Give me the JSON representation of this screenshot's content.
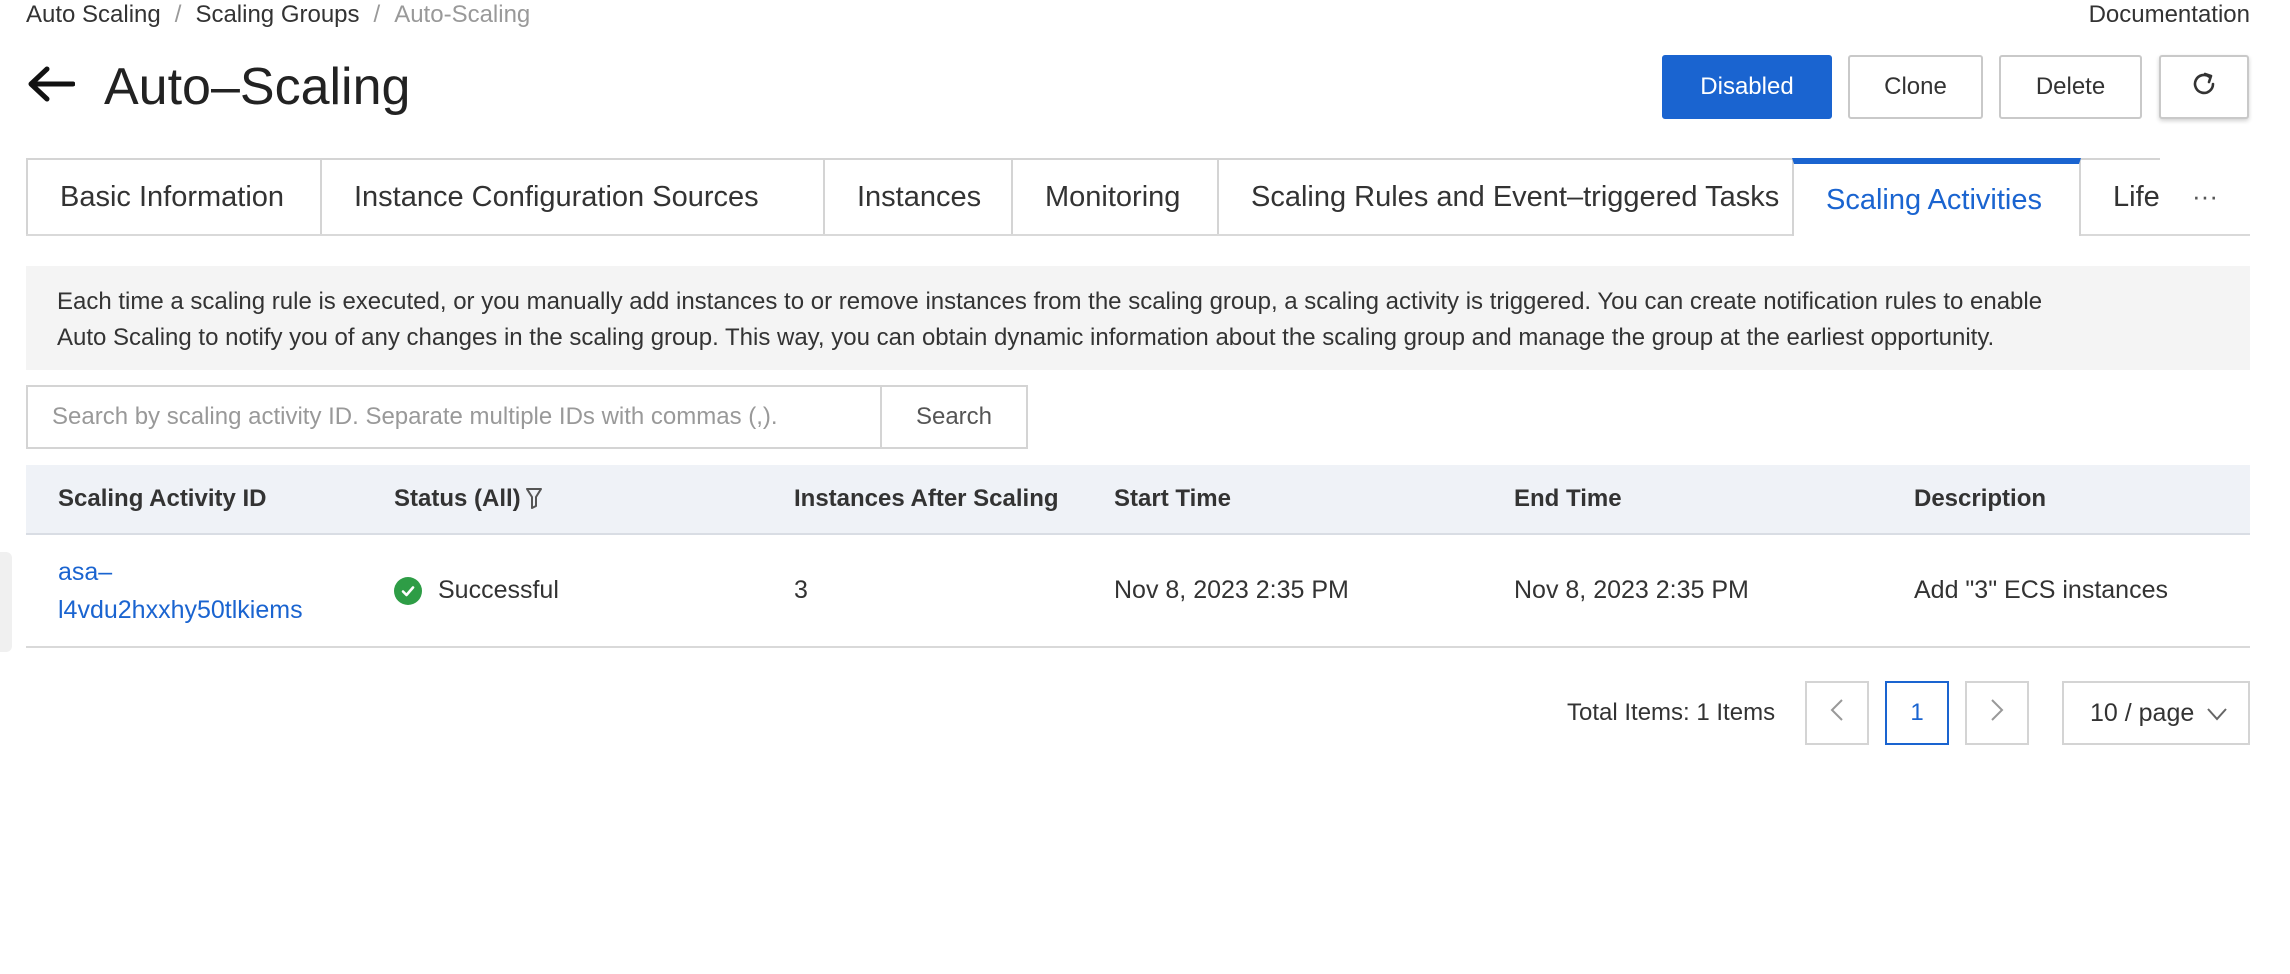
{
  "breadcrumb": [
    "Auto Scaling",
    "Scaling Groups",
    "Auto-Scaling"
  ],
  "header": {
    "documentation": "Documentation",
    "title": "Auto–Scaling",
    "buttons": {
      "disabled": "Disabled",
      "clone": "Clone",
      "delete": "Delete"
    }
  },
  "tabs": [
    "Basic Information",
    "Instance Configuration Sources",
    "Instances",
    "Monitoring",
    "Scaling Rules and Event–triggered Tasks",
    "Scaling Activities",
    "Life",
    "···"
  ],
  "notice": {
    "line1": "Each time a scaling rule is executed, or you manually add instances to or remove instances from the scaling group, a scaling activity is triggered. You can create notification rules to enable",
    "line2": "Auto Scaling to notify you of any changes in the scaling group. This way, you can obtain dynamic information about the scaling group and manage the group at the earliest opportunity."
  },
  "search": {
    "placeholder": "Search by scaling activity ID. Separate multiple IDs with commas (,).",
    "button": "Search"
  },
  "table": {
    "columns": [
      "Scaling Activity ID",
      "Status (All)",
      "Instances After Scaling",
      "Start Time",
      "End Time",
      "Description"
    ],
    "rows": [
      {
        "id_line1": "asa–",
        "id_line2": "l4vdu2hxxhy50tlkiems",
        "status": "Successful",
        "instances": "3",
        "start": "Nov 8, 2023 2:35 PM",
        "end": "Nov 8, 2023 2:35 PM",
        "description": "Add \"3\" ECS instances"
      }
    ]
  },
  "pagination": {
    "total": "Total Items: 1 Items",
    "current": "1",
    "page_size": "10 / page"
  },
  "colors": {
    "primary": "#1a64d0",
    "success": "#2e9d46"
  }
}
